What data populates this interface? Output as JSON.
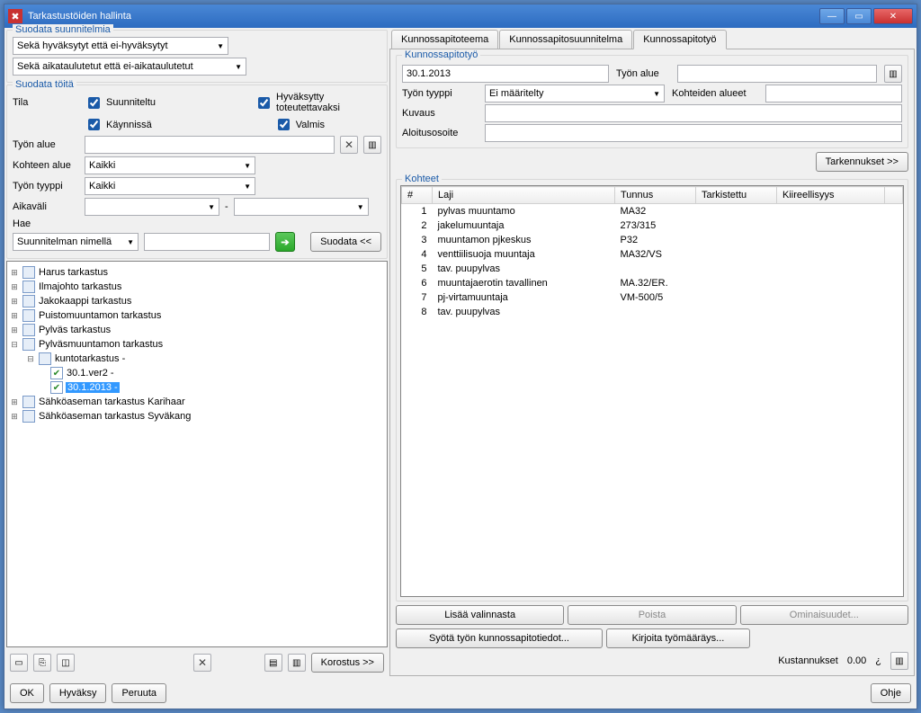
{
  "window": {
    "title": "Tarkastustöiden hallinta"
  },
  "left": {
    "filter_plans": {
      "title": "Suodata suunnitelmia",
      "approval": "Sekä hyväksytyt että ei-hyväksytyt",
      "scheduled": "Sekä aikataulutetut että ei-aikataulutetut"
    },
    "filter_jobs": {
      "title": "Suodata töitä",
      "tila_label": "Tila",
      "suunniteltu": "Suunniteltu",
      "hyvaksytty": "Hyväksytty toteutettavaksi",
      "kaynnissa": "Käynnissä",
      "valmis": "Valmis",
      "tyon_alue": "Työn alue",
      "kohteen_alue": "Kohteen alue",
      "kohteen_alue_val": "Kaikki",
      "tyon_tyyppi": "Työn tyyppi",
      "tyon_tyyppi_val": "Kaikki",
      "aikavali": "Aikaväli",
      "dash": "-",
      "hae": "Hae",
      "hae_val": "Suunnitelman nimellä",
      "suodata_btn": "Suodata <<"
    },
    "tree": [
      "Harus tarkastus",
      "Ilmajohto tarkastus",
      "Jakokaappi tarkastus",
      "Puistomuuntamon tarkastus",
      "Pylväs tarkastus",
      "Pylväsmuuntamon tarkastus",
      "kuntotarkastus -",
      "30.1.ver2 -"
    ],
    "tree_sel": "30.1.2013 -",
    "tree_after": [
      "Sähköaseman tarkastus Karihaar",
      "Sähköaseman tarkastus Syväkang"
    ],
    "korostus": "Korostus >>"
  },
  "tabs": {
    "t1": "Kunnossapitoteema",
    "t2": "Kunnossapitosuunnitelma",
    "t3": "Kunnossapitotyö"
  },
  "right": {
    "groupTitle": "Kunnossapitotyö",
    "date": "30.1.2013",
    "tyon_alue": "Työn alue",
    "tyon_tyyppi": "Työn tyyppi",
    "tyon_tyyppi_val": "Ei määritelty",
    "kohteiden_alueet": "Kohteiden alueet",
    "kuvaus": "Kuvaus",
    "aloitusosoite": "Aloitusosoite",
    "tarkennukset": "Tarkennukset >>",
    "kohteet": "Kohteet",
    "cols": {
      "n": "#",
      "laji": "Laji",
      "tunnus": "Tunnus",
      "tark": "Tarkistettu",
      "kiir": "Kiireellisyys"
    },
    "rows": [
      {
        "n": "1",
        "laji": "pylvas muuntamo",
        "tunnus": "MA32"
      },
      {
        "n": "2",
        "laji": "jakelumuuntaja",
        "tunnus": "273/315"
      },
      {
        "n": "3",
        "laji": "muuntamon pjkeskus",
        "tunnus": "P32"
      },
      {
        "n": "4",
        "laji": "venttiilisuoja muuntaja",
        "tunnus": "MA32/VS"
      },
      {
        "n": "5",
        "laji": "tav. puupylvas",
        "tunnus": "<?>"
      },
      {
        "n": "6",
        "laji": "muuntajaerotin tavallinen",
        "tunnus": "MA.32/ER."
      },
      {
        "n": "7",
        "laji": "pj-virtamuuntaja",
        "tunnus": "VM-500/5"
      },
      {
        "n": "8",
        "laji": "tav. puupylvas",
        "tunnus": "<?>"
      }
    ],
    "btn_add": "Lisää valinnasta",
    "btn_del": "Poista",
    "btn_props": "Ominaisuudet...",
    "btn_syota": "Syötä työn kunnossapitotiedot...",
    "btn_kirjoita": "Kirjoita työmääräys...",
    "kustannukset_label": "Kustannukset",
    "kustannukset_val": "0.00"
  },
  "footer": {
    "ok": "OK",
    "hyvaksy": "Hyväksy",
    "peruuta": "Peruuta",
    "ohje": "Ohje"
  }
}
